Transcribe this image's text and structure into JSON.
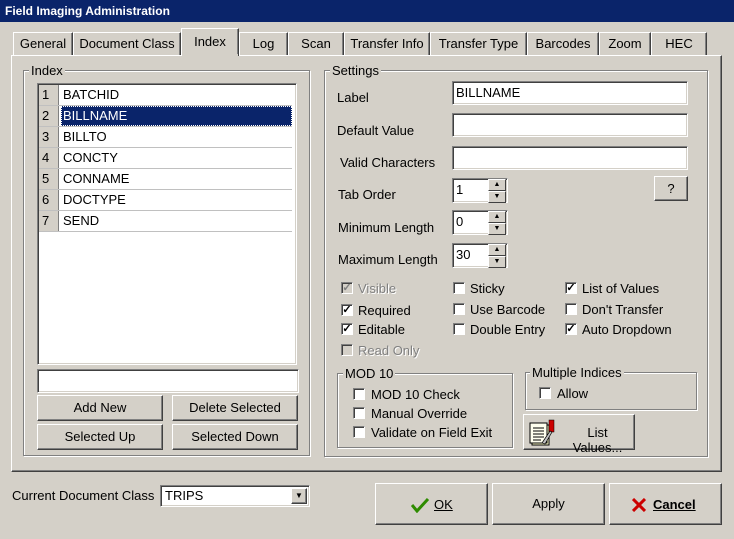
{
  "window": {
    "title": "Field Imaging Administration"
  },
  "tabs": [
    "General",
    "Document Class",
    "Index",
    "Log",
    "Scan",
    "Transfer Info",
    "Transfer Type",
    "Barcodes",
    "Zoom",
    "HEC"
  ],
  "index": {
    "legend": "Index",
    "rows": [
      {
        "num": "1",
        "name": "BATCHID"
      },
      {
        "num": "2",
        "name": "BILLNAME"
      },
      {
        "num": "3",
        "name": "BILLTO"
      },
      {
        "num": "4",
        "name": "CONCTY"
      },
      {
        "num": "5",
        "name": "CONNAME"
      },
      {
        "num": "6",
        "name": "DOCTYPE"
      },
      {
        "num": "7",
        "name": "SEND"
      }
    ],
    "new_value": "",
    "buttons": {
      "add_new": "Add New",
      "delete_selected": "Delete Selected",
      "selected_up": "Selected Up",
      "selected_down": "Selected Down"
    }
  },
  "settings": {
    "legend": "Settings",
    "label_caption": "Label",
    "label_value": "BILLNAME",
    "default_caption": "Default Value",
    "default_value": "",
    "valid_caption": "Valid Characters",
    "valid_value": "",
    "help_button": "?",
    "tab_order_caption": "Tab Order",
    "tab_order_value": "1",
    "min_caption": "Minimum Length",
    "min_value": "0",
    "max_caption": "Maximum Length",
    "max_value": "30",
    "checks": {
      "visible": {
        "label": "Visible",
        "checked": true,
        "disabled": true
      },
      "required": {
        "label": "Required",
        "checked": true
      },
      "editable": {
        "label": "Editable",
        "checked": true
      },
      "read_only": {
        "label": "Read Only",
        "checked": false,
        "disabled": true
      },
      "sticky": {
        "label": "Sticky",
        "checked": false
      },
      "use_barcode": {
        "label": "Use Barcode",
        "checked": false
      },
      "double_entry": {
        "label": "Double Entry",
        "checked": false
      },
      "list_of_values": {
        "label": "List of Values",
        "checked": true
      },
      "dont_transfer": {
        "label": "Don't Transfer",
        "checked": false
      },
      "auto_dropdown": {
        "label": "Auto Dropdown",
        "checked": true
      }
    },
    "mod10": {
      "legend": "MOD 10",
      "check": {
        "label": "MOD 10 Check",
        "checked": false
      },
      "override": {
        "label": "Manual Override",
        "checked": false
      },
      "validate": {
        "label": "Validate on Field Exit",
        "checked": false
      }
    },
    "multi": {
      "legend": "Multiple Indices",
      "allow": {
        "label": "Allow",
        "checked": false
      }
    },
    "list_values_button": "List Values..."
  },
  "footer": {
    "doc_class_caption": "Current Document Class",
    "doc_class_value": "TRIPS",
    "ok": "OK",
    "apply": "Apply",
    "cancel": "Cancel"
  },
  "colors": {
    "titlebar": "#0a246a",
    "selection": "#0a246a",
    "face": "#d4d0c8"
  }
}
